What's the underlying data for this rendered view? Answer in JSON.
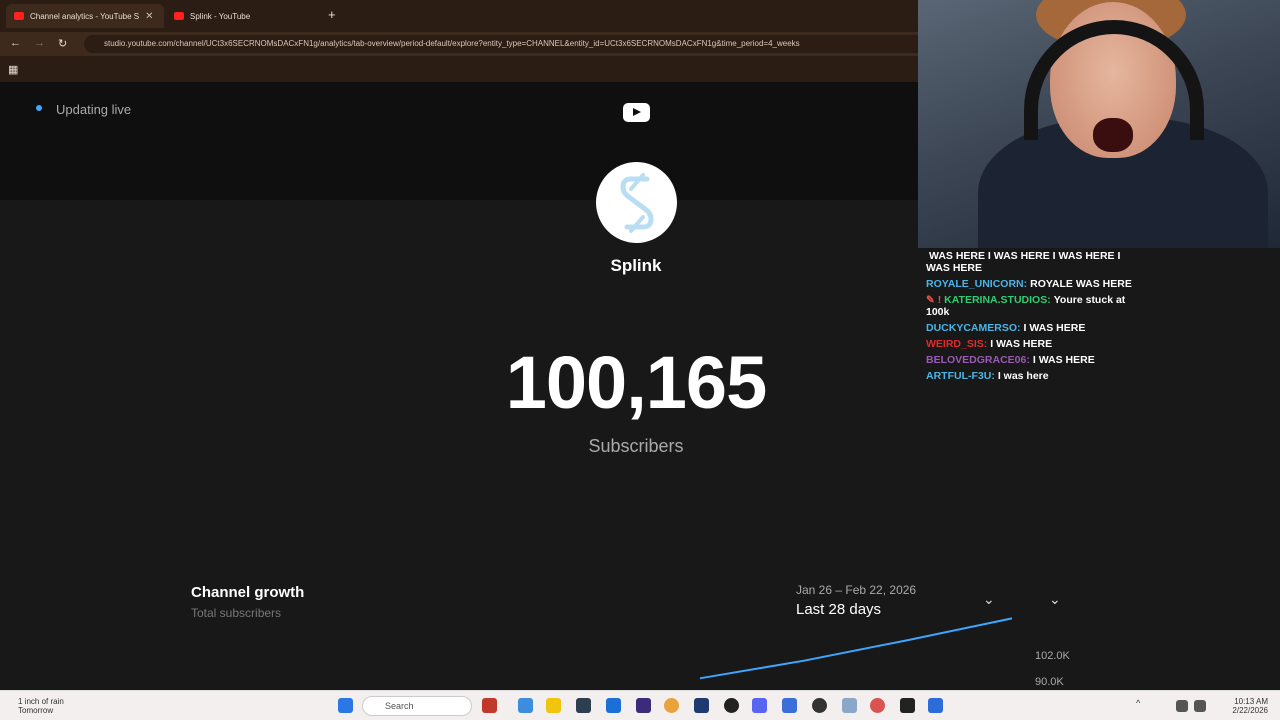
{
  "browser": {
    "tabs": [
      {
        "label": "Channel analytics - YouTube S"
      },
      {
        "label": "Splink - YouTube"
      }
    ],
    "new_tab": "+",
    "url": "studio.youtube.com/channel/UCt3x6SECRNOMsDACxFN1g/analytics/tab-overview/period-default/explore?entity_type=CHANNEL&entity_id=UCt3x6SECRNOMsDACxFN1g&time_period=4_weeks"
  },
  "status": {
    "live_text": "Updating live"
  },
  "channel": {
    "name": "Splink",
    "subscriber_count": "100,165",
    "subscriber_label": "Subscribers"
  },
  "growth": {
    "title": "Channel growth",
    "subtitle": "Total subscribers",
    "range_dates": "Jan 26 – Feb 22, 2026",
    "range_label": "Last 28 days"
  },
  "chart_data": {
    "type": "line",
    "y_tick_labels": [
      "102.0K",
      "90.0K"
    ],
    "series": [
      {
        "values": [
          90.0,
          93.0,
          96.5,
          100.2
        ]
      }
    ],
    "ylim": [
      88.0,
      103.0
    ],
    "color": "#3ea6ff"
  },
  "chat": [
    {
      "name": "",
      "name_color": "#ffffff",
      "text": "WAS HERE I WAS HERE I WAS HERE I WAS HERE"
    },
    {
      "name": "ROYALE_UNICORN:",
      "name_color": "#4bb4e6",
      "text": "ROYALE WAS HERE"
    },
    {
      "name": "KATERINA.STUDIOS:",
      "name_color": "#2ecc71",
      "text": "Youre stuck at 100k"
    },
    {
      "name": "DUCKYCAMERSO:",
      "name_color": "#4bb4e6",
      "text": "I WAS HERE"
    },
    {
      "name": "WEIRD_SIS:",
      "name_color": "#e02b2b",
      "text": "I WAS HERE"
    },
    {
      "name": "BELOVEDGRACE06:",
      "name_color": "#9b59b6",
      "text": "I WAS HERE"
    },
    {
      "name": "ARTFUL-F3U:",
      "name_color": "#4bb4e6",
      "text": "I was here"
    }
  ],
  "taskbar": {
    "weather_line1": "1 inch of rain",
    "weather_line2": "Tomorrow",
    "search_placeholder": "Search",
    "clock_time": "10:13 AM",
    "clock_date": "2/22/2026"
  },
  "colors": {
    "accent": "#3ea6ff",
    "page_bg": "#181818",
    "banner_bg": "#0f0f0f"
  }
}
